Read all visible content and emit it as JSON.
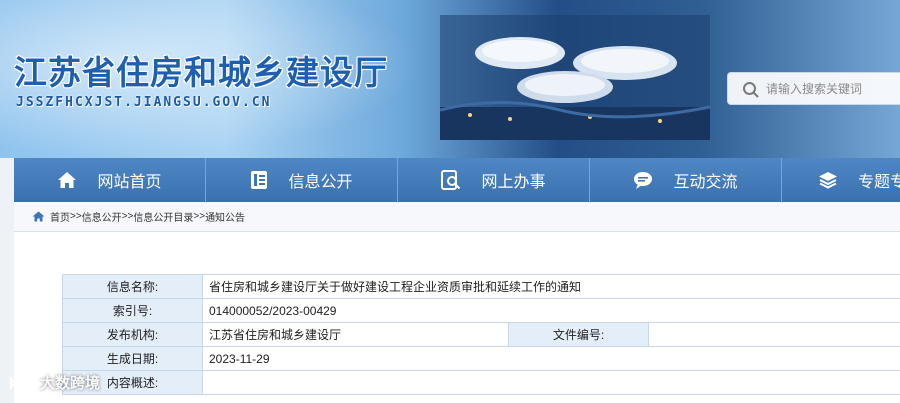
{
  "header": {
    "site_title": "江苏省住房和城乡建设厅",
    "site_domain": "JSSZFHCXJST.JIANGSU.GOV.CN",
    "search_placeholder": "请输入搜索关键词",
    "brand_color": "#1f5fb0"
  },
  "nav": {
    "items": [
      {
        "label": "网站首页",
        "icon": "home-icon"
      },
      {
        "label": "信息公开",
        "icon": "document-icon"
      },
      {
        "label": "网上办事",
        "icon": "search-doc-icon"
      },
      {
        "label": "互动交流",
        "icon": "chat-icon"
      },
      {
        "label": "专题专",
        "icon": "layers-icon"
      }
    ],
    "bar_color": "#4479bb"
  },
  "breadcrumb": {
    "icon": "home-icon",
    "items": [
      "首页",
      "信息公开",
      "信息公开目录",
      "通知公告"
    ],
    "separator": ">>"
  },
  "meta": {
    "name_label": "信息名称:",
    "name_value": "省住房和城乡建设厅关于做好建设工程企业资质审批和延续工作的通知",
    "index_label": "索引号:",
    "index_value": "014000052/2023-00429",
    "publisher_label": "发布机构:",
    "publisher_value": "江苏省住房和城乡建设厅",
    "docno_label": "文件编号:",
    "docno_value": "",
    "date_label": "生成日期:",
    "date_value": "2023-11-29",
    "summary_label": "内容概述:",
    "summary_value": ""
  },
  "watermark": {
    "text": "大数跨境"
  }
}
